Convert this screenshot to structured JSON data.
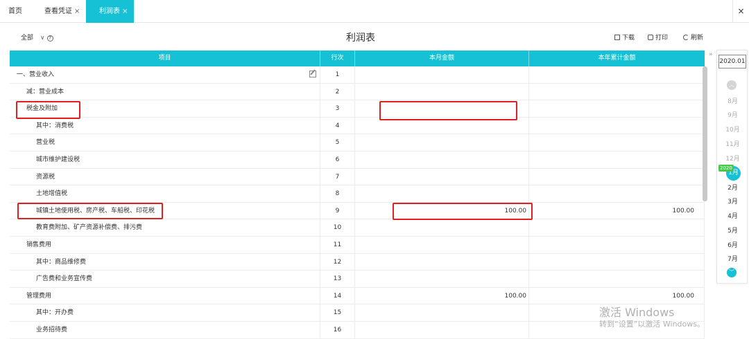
{
  "tabs": [
    {
      "label": "首页"
    },
    {
      "label": "查看凭证",
      "close": "×"
    },
    {
      "label": "利润表",
      "close": "×"
    }
  ],
  "tab_close_all": "×",
  "toolbar": {
    "scope": "全部",
    "title": "利润表",
    "download": "下载",
    "print": "打印",
    "refresh": "刷新"
  },
  "headers": {
    "item": "项目",
    "index": "行次",
    "month": "本月金额",
    "year": "本年累计金额"
  },
  "rows": [
    {
      "label": "一、营业收入",
      "index": "1",
      "month": "",
      "year": ""
    },
    {
      "label": "减：营业成本",
      "index": "2",
      "month": "",
      "year": ""
    },
    {
      "label": "税金及附加",
      "index": "3",
      "month": "",
      "year": ""
    },
    {
      "label": "其中：消费税",
      "index": "4",
      "month": "",
      "year": ""
    },
    {
      "label": "营业税",
      "index": "5",
      "month": "",
      "year": ""
    },
    {
      "label": "城市维护建设税",
      "index": "6",
      "month": "",
      "year": ""
    },
    {
      "label": "资源税",
      "index": "7",
      "month": "",
      "year": ""
    },
    {
      "label": "土地增值税",
      "index": "8",
      "month": "",
      "year": ""
    },
    {
      "label": "城镇土地使用税、房产税、车船税、印花税",
      "index": "9",
      "month": "100.00",
      "year": "100.00"
    },
    {
      "label": "教育费附加、矿产资源补偿费、排污费",
      "index": "10",
      "month": "",
      "year": ""
    },
    {
      "label": "销售费用",
      "index": "11",
      "month": "",
      "year": ""
    },
    {
      "label": "其中：商品维修费",
      "index": "12",
      "month": "",
      "year": ""
    },
    {
      "label": "广告费和业务宣传费",
      "index": "13",
      "month": "",
      "year": ""
    },
    {
      "label": "管理费用",
      "index": "14",
      "month": "100.00",
      "year": "100.00"
    },
    {
      "label": "其中：开办费",
      "index": "15",
      "month": "",
      "year": ""
    },
    {
      "label": "业务招待费",
      "index": "16",
      "month": "",
      "year": ""
    }
  ],
  "period": {
    "selected_period": "2020.01",
    "months_before": [
      "8月",
      "9月",
      "10月",
      "11月",
      "12月"
    ],
    "year_badge": "2020",
    "selected_month": "1月",
    "months_after": [
      "2月",
      "3月",
      "4月",
      "5月",
      "6月",
      "7月"
    ]
  },
  "watermark": {
    "line1": "激活 Windows",
    "line2": "转到“设置”以激活 Windows。"
  },
  "colors": {
    "accent": "#16c1d6",
    "highlight": "#e02020",
    "badge": "#45c94a"
  }
}
